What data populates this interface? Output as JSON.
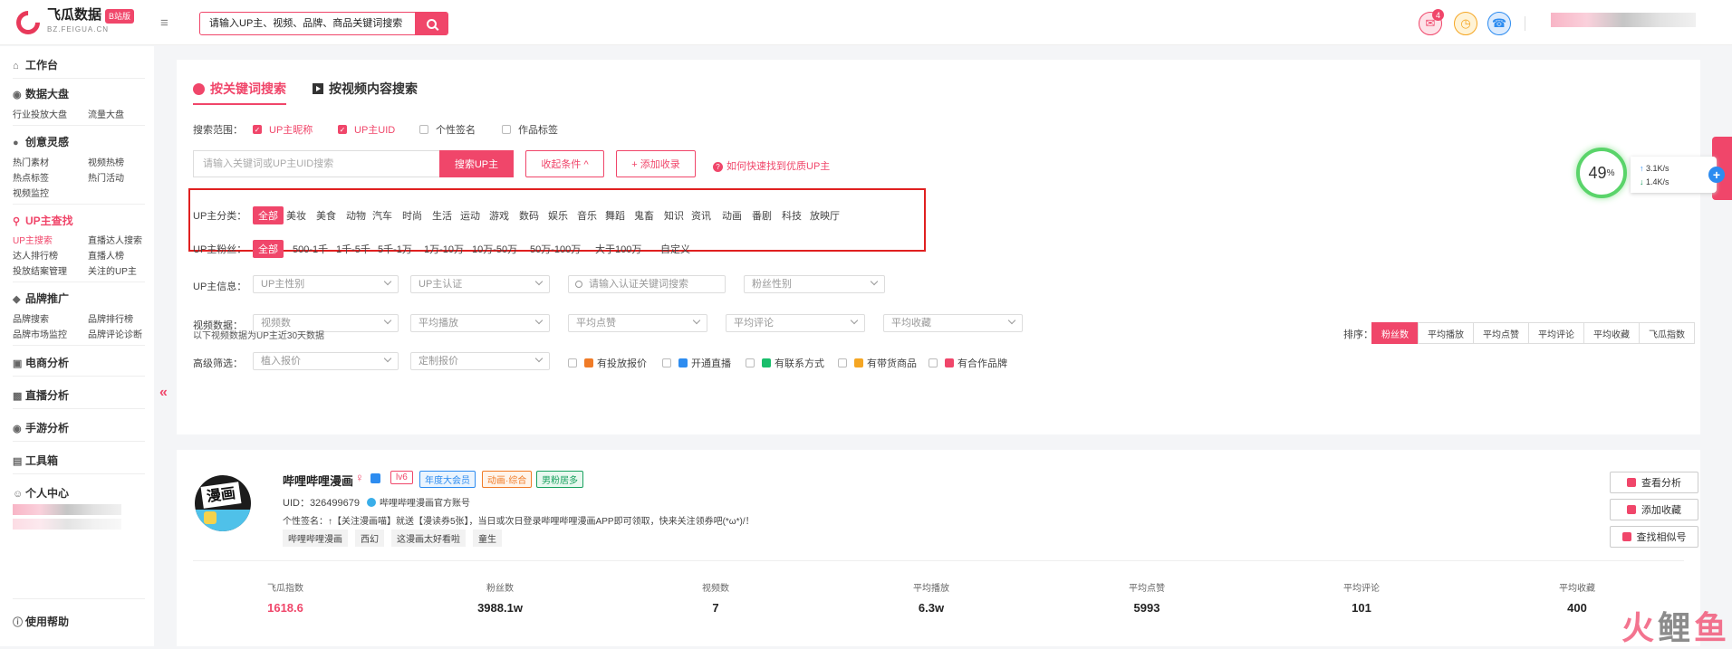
{
  "header": {
    "brand": "飞瓜数据",
    "brand_badge": "B站版",
    "brand_sub": "BZ.FEIGUA.CN",
    "search_placeholder": "请输入UP主、视频、品牌、商品关键词搜索",
    "mail_badge": "4"
  },
  "sidebar": {
    "workbench": "工作台",
    "data_board": "数据大盘",
    "data_board_items": [
      "行业投放大盘",
      "流量大盘"
    ],
    "creative": "创意灵感",
    "creative_items": [
      "热门素材",
      "视频热榜",
      "热点标签",
      "热门活动",
      "视频监控"
    ],
    "up_search": "UP主查找",
    "up_items": [
      "UP主搜索",
      "直播达人搜索",
      "达人排行榜",
      "直播人榜",
      "投放结案管理",
      "关注的UP主"
    ],
    "brand": "品牌推广",
    "brand_items": [
      "品牌搜索",
      "品牌排行榜",
      "品牌市场监控",
      "品牌评论诊断"
    ],
    "ecom": "电商分析",
    "live": "直播分析",
    "game": "手游分析",
    "tools": "工具箱",
    "personal": "个人中心",
    "help": "使用帮助"
  },
  "tabs": {
    "keyword": "按关键词搜索",
    "video": "按视频内容搜索"
  },
  "scope": {
    "label": "搜索范围：",
    "options": [
      {
        "label": "UP主昵称",
        "checked": true
      },
      {
        "label": "UP主UID",
        "checked": true
      },
      {
        "label": "个性签名",
        "checked": false
      },
      {
        "label": "作品标签",
        "checked": false
      }
    ]
  },
  "keyword": {
    "placeholder": "请输入关键词或UP主UID搜索",
    "search_btn": "搜索UP主",
    "collapse_btn": "收起条件 ^",
    "add_btn": "+ 添加收录",
    "help_link": "如何快速找到优质UP主"
  },
  "category": {
    "label": "UP主分类：",
    "items": [
      "全部",
      "美妆",
      "美食",
      "动物",
      "汽车",
      "时尚",
      "生活",
      "运动",
      "游戏",
      "数码",
      "娱乐",
      "音乐",
      "舞蹈",
      "鬼畜",
      "知识",
      "资讯",
      "动画",
      "番剧",
      "科技",
      "放映厅"
    ]
  },
  "fans": {
    "label": "UP主粉丝：",
    "items": [
      "全部",
      "500-1千",
      "1千-5千",
      "5千-1万",
      "1万-10万",
      "10万-50万",
      "50万-100万",
      "大于100万",
      "自定义"
    ]
  },
  "info": {
    "label": "UP主信息：",
    "gender": "UP主性别",
    "cert": "UP主认证",
    "cert_kw": "请输入认证关键词搜索",
    "fan_gender": "粉丝性别"
  },
  "video_data": {
    "label": "视频数据：",
    "selects": [
      "视频数",
      "平均播放",
      "平均点赞",
      "平均评论",
      "平均收藏"
    ]
  },
  "advanced": {
    "label": "高级筛选：",
    "selects": [
      "植入报价",
      "定制报价"
    ],
    "checks": [
      "有投放报价",
      "开通直播",
      "有联系方式",
      "有带货商品",
      "有合作品牌"
    ]
  },
  "note": "以下视频数据为UP主近30天数据",
  "sort": {
    "label": "排序：",
    "items": [
      "粉丝数",
      "平均播放",
      "平均点赞",
      "平均评论",
      "平均收藏",
      "飞瓜指数"
    ]
  },
  "card": {
    "name": "哔哩哔哩漫画",
    "tags": [
      "lv6",
      "年度大会员",
      "动画·综合",
      "男粉居多"
    ],
    "uid": "UID：326499679",
    "verify": "哔哩哔哩漫画官方账号",
    "signature": "个性签名：↑【关注漫画喵】就送【漫读券5张】，当日或次日登录哔哩哔哩漫画APP即可领取，快来关注领券吧(*ω*)/！",
    "content_tags": [
      "哔哩哔哩漫画",
      "西幻",
      "这漫画太好看啦",
      "童生"
    ],
    "actions": [
      "查看分析",
      "添加收藏",
      "查找相似号"
    ],
    "avatar_text": "漫画",
    "stats": [
      {
        "label": "飞瓜指数",
        "value": "1618.6"
      },
      {
        "label": "粉丝数",
        "value": "3988.1w"
      },
      {
        "label": "视频数",
        "value": "7"
      },
      {
        "label": "平均播放",
        "value": "6.3w"
      },
      {
        "label": "平均点赞",
        "value": "5993"
      },
      {
        "label": "平均评论",
        "value": "101"
      },
      {
        "label": "平均收藏",
        "value": "400"
      }
    ]
  },
  "widget": {
    "percent": "49",
    "percent_unit": "%",
    "up": "3.1K/s",
    "down": "1.4K/s"
  },
  "watermark": {
    "a": "火",
    "b": "鲤",
    "c": "鱼"
  }
}
